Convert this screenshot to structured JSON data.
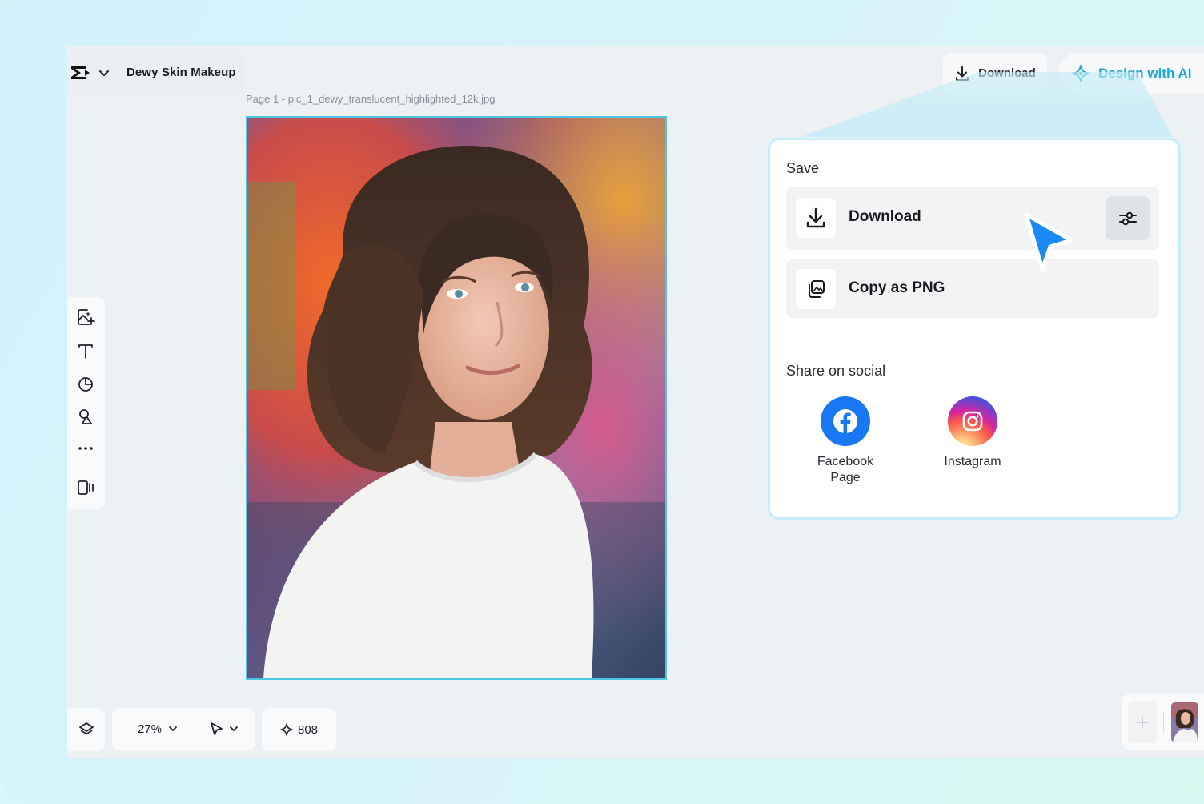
{
  "project": {
    "title": "Dewy Skin Makeup",
    "logo_icon": "capcut-logo-icon",
    "menu_icon": "chevron-down-icon"
  },
  "canvas": {
    "page_label": "Page 1 -  pic_1_dewy_translucent_highlighted_12k.jpg",
    "image_alt": "Portrait photo of a woman with wavy brown hair in a white t-shirt against a colorful blurred background"
  },
  "header": {
    "download_label": "Download",
    "design_ai_label": "Design with AI",
    "accent_color": "#17a7dd"
  },
  "export_panel": {
    "save_heading": "Save",
    "download_label": "Download",
    "copy_label": "Copy as PNG",
    "share_heading": "Share on social",
    "socials": [
      {
        "name_line1": "Facebook",
        "name_line2": "Page",
        "icon": "facebook-icon",
        "color": "#1877f2"
      },
      {
        "name_line1": "Instagram",
        "name_line2": "",
        "icon": "instagram-icon",
        "color": "#d6249f"
      }
    ]
  },
  "left_toolbar": {
    "tools": [
      "add-image-icon",
      "text-icon",
      "shapes-icon",
      "elements-icon",
      "more-icon",
      "panel-toggle-icon"
    ]
  },
  "bottom_bar": {
    "zoom": "27%",
    "credits": "808"
  }
}
